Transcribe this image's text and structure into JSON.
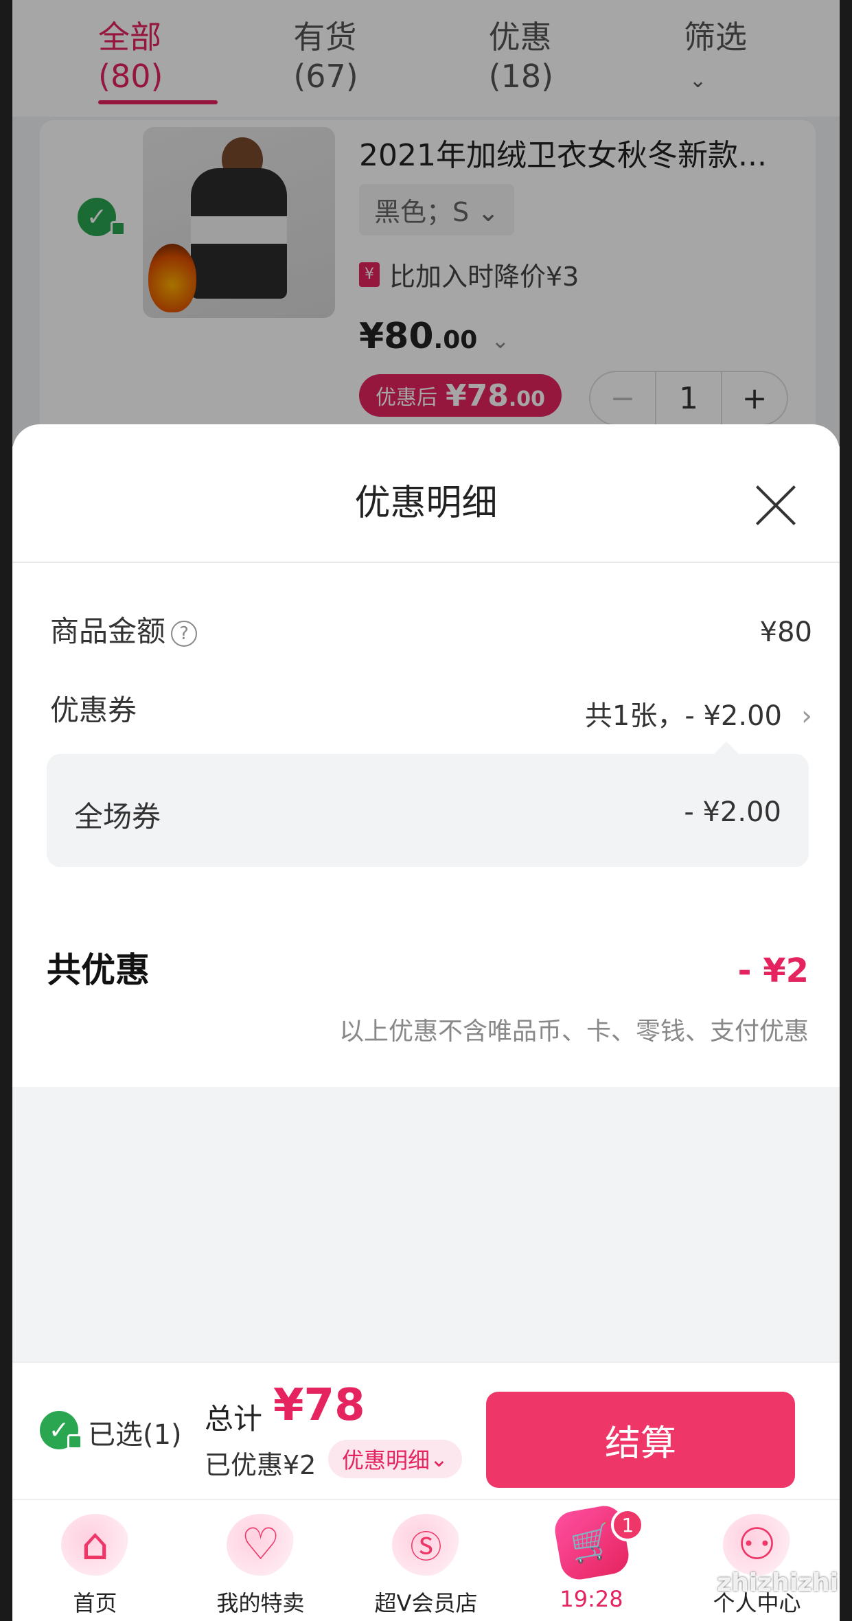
{
  "tabs": [
    {
      "label": "全部(80)"
    },
    {
      "label": "有货(67)"
    },
    {
      "label": "优惠(18)"
    },
    {
      "label": "筛选"
    }
  ],
  "product": {
    "title": "2021年加绒卫衣女秋冬新款...",
    "sku": "黑色；S",
    "price_drop": "比加入时降价¥3",
    "price_main": "¥80",
    "price_decimal": ".00",
    "after_label": "优惠后",
    "after_main": "¥78",
    "after_decimal": ".00",
    "qty": "1",
    "minus": "−",
    "plus": "+"
  },
  "sheet": {
    "title": "优惠明细",
    "goods_label": "商品金额",
    "goods_value": "¥80",
    "coupon_label": "优惠券",
    "coupon_value": "共1张，- ¥2.00",
    "coupon_item_label": "全场券",
    "coupon_item_value": "- ¥2.00",
    "total_label": "共优惠",
    "total_value": "- ¥2",
    "note": "以上优惠不含唯品币、卡、零钱、支付优惠"
  },
  "checkout": {
    "selected": "已选(1)",
    "sum_label": "总计",
    "sum_value": "¥78",
    "saved": "已优惠¥2",
    "detail": "优惠明细",
    "pay": "结算"
  },
  "nav": [
    {
      "label": "首页",
      "icon": "home-icon"
    },
    {
      "label": "我的特卖",
      "icon": "heart-icon"
    },
    {
      "label": "超V会员店",
      "icon": "vip-store-icon"
    },
    {
      "label": "19:28",
      "icon": "cart-icon",
      "badge": "1"
    },
    {
      "label": "个人中心",
      "icon": "user-icon"
    }
  ],
  "watermark": "zhizhizhi"
}
